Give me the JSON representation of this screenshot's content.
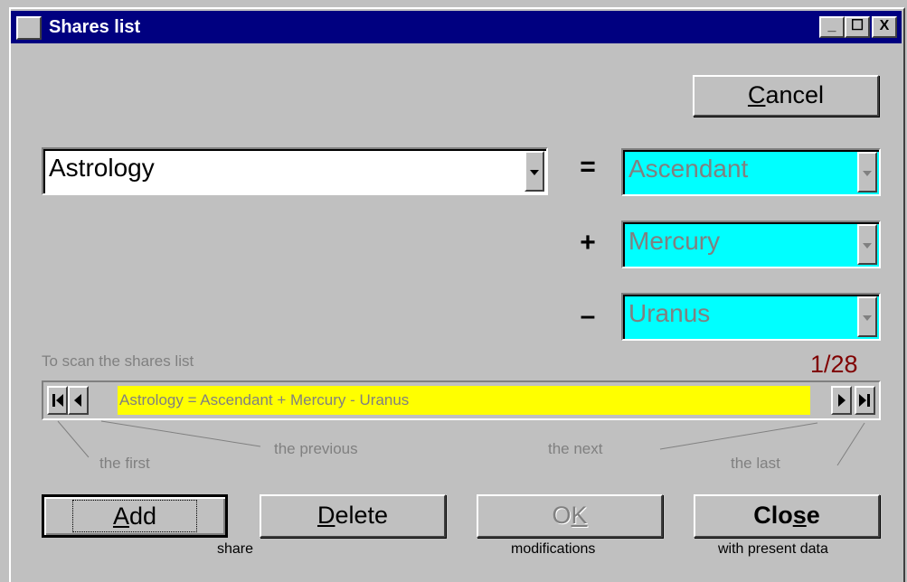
{
  "window": {
    "title": "Shares list",
    "minimize_glyph": "_",
    "maximize_glyph": "☐",
    "close_glyph": "X"
  },
  "cancel_button": {
    "accel": "C",
    "rest": "ancel"
  },
  "share_combo": {
    "value": "Astrology"
  },
  "operators": {
    "equals": "=",
    "plus": "+",
    "minus": "–"
  },
  "planet_combos": [
    {
      "value": "Ascendant"
    },
    {
      "value": "Mercury"
    },
    {
      "value": "Uranus"
    }
  ],
  "planet_combo_color": "#00ffff",
  "scan_label": "To scan the shares list",
  "record_counter": "1/28",
  "counter_color": "#800000",
  "nav_formula": "Astrology = Ascendant + Mercury - Uranus",
  "nav_color": "#ffff00",
  "nav_hints": {
    "first": "the first",
    "previous": "the previous",
    "next": "the next",
    "last": "the last"
  },
  "buttons": {
    "add": {
      "accel": "A",
      "rest": "dd",
      "caption": "share"
    },
    "delete": {
      "accel": "D",
      "rest": "elete"
    },
    "ok": {
      "pre": "O",
      "accel": "K",
      "caption": "modifications"
    },
    "close": {
      "pre": "Clo",
      "accel": "s",
      "rest": "e",
      "caption": "with present data"
    }
  }
}
